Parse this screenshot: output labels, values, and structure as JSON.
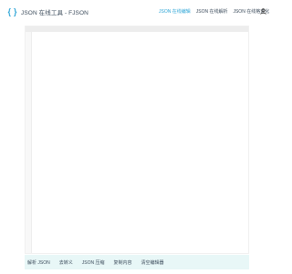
{
  "header": {
    "title": "JSON 在线工具 - FJSON",
    "logo_icon": "json-braces-icon",
    "accent_color": "#2aa4d6",
    "nav": [
      {
        "label": "JSON 在线编辑",
        "active": true
      },
      {
        "label": "JSON 在线解析",
        "active": false
      },
      {
        "label": "JSON 在线格式化",
        "active": false
      }
    ],
    "user_icon": "user-icon"
  },
  "editor": {
    "content": ""
  },
  "toolbar": {
    "background": "#e8f7f7",
    "buttons": [
      {
        "label": "解析 JSON"
      },
      {
        "label": "去转义"
      },
      {
        "label": "JSON 压缩"
      },
      {
        "label": "复制内容"
      },
      {
        "label": "清空编辑器"
      }
    ]
  }
}
